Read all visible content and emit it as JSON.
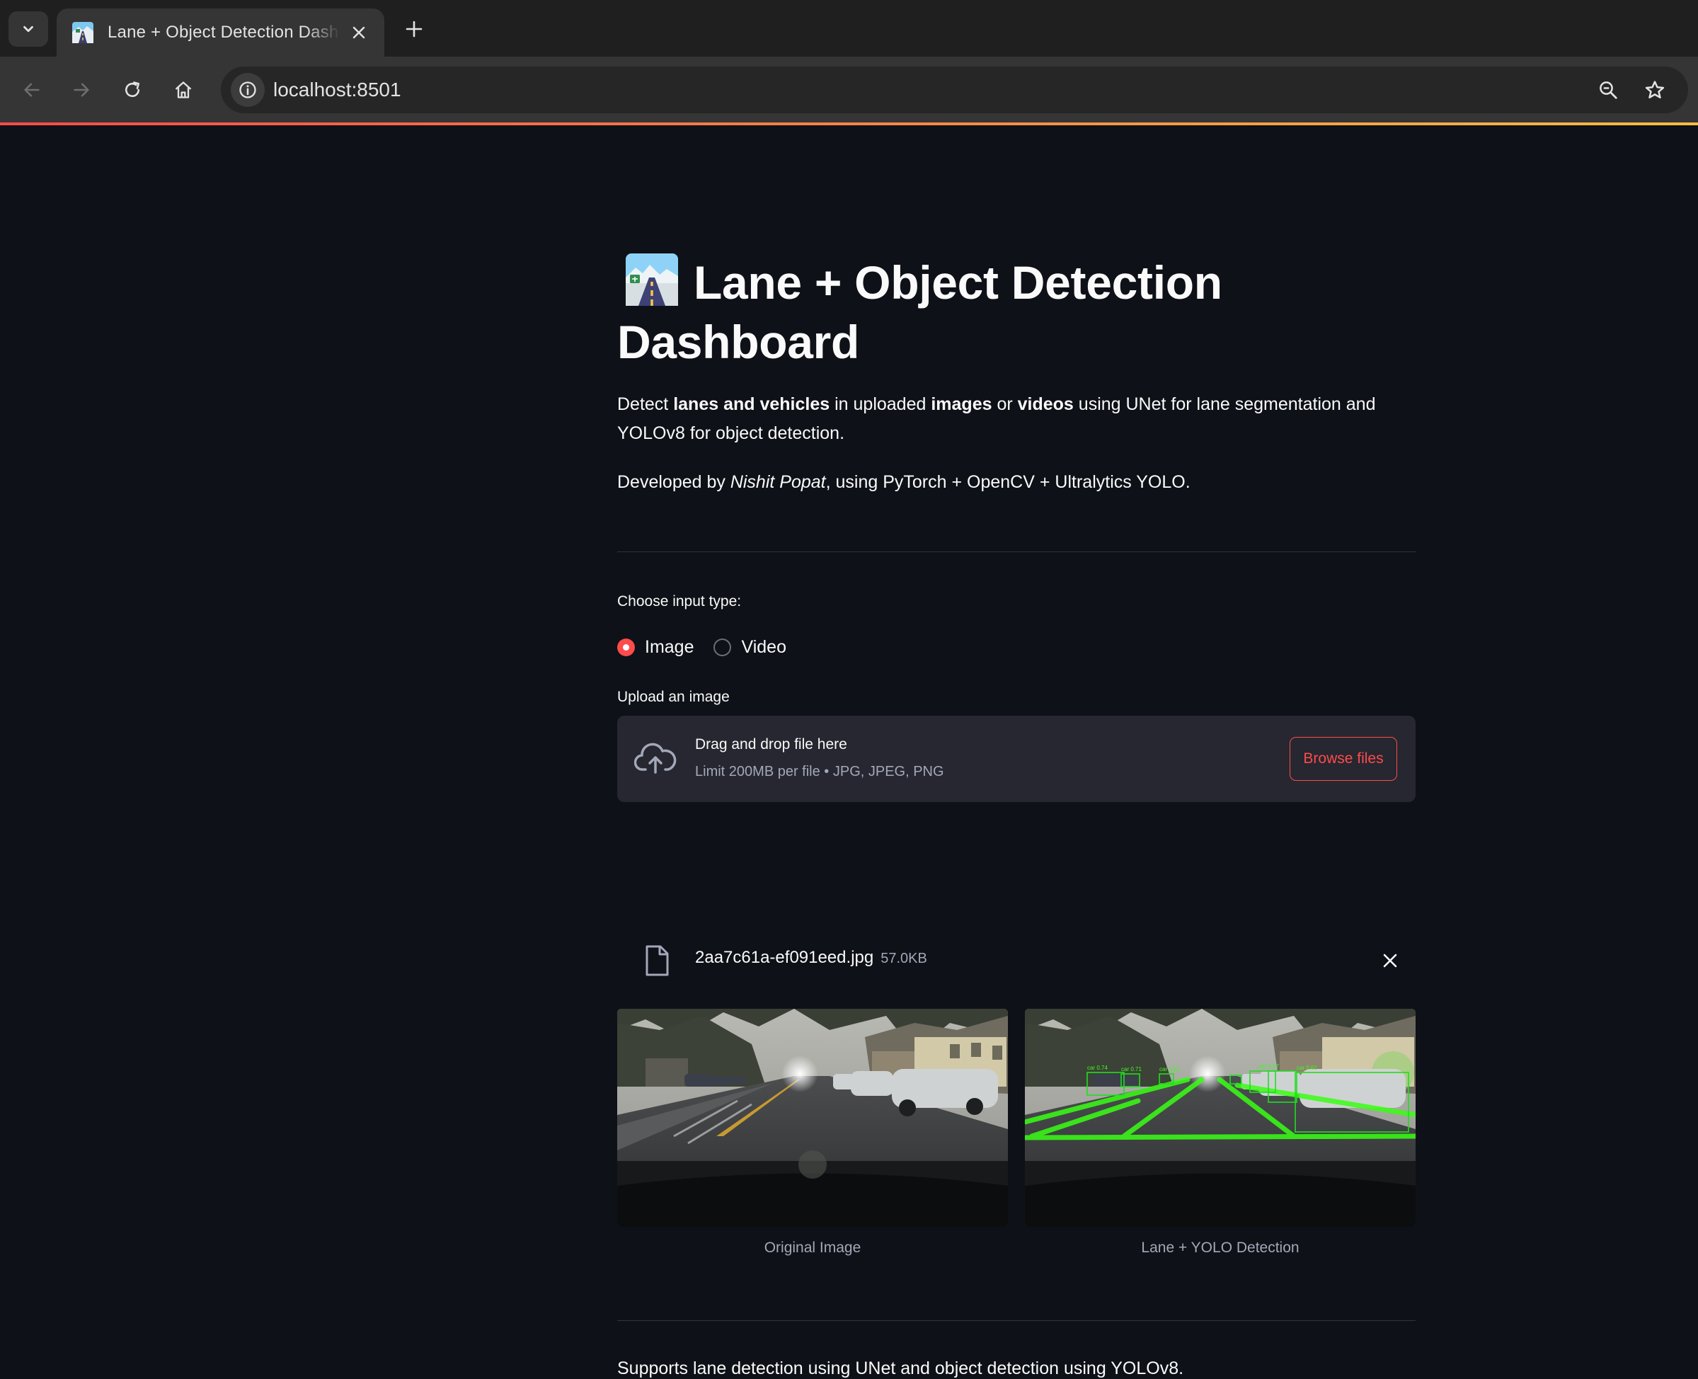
{
  "browser": {
    "tab_title": "Lane + Object Detection Dashboard",
    "url": "localhost:8501"
  },
  "app": {
    "title": "Lane + Object Detection Dashboard",
    "description": {
      "p1": "Detect ",
      "b1": "lanes and vehicles",
      "p2": " in uploaded ",
      "b2": "images",
      "p3": " or ",
      "b3": "videos",
      "p4": " using UNet for lane segmentation and YOLOv8 for object detection."
    },
    "developer": {
      "prefix": "Developed by ",
      "name": "Nishit Popat",
      "suffix": ", using PyTorch + OpenCV + Ultralytics YOLO."
    },
    "input_type": {
      "label": "Choose input type:",
      "options": [
        "Image",
        "Video"
      ],
      "selected": "Image"
    },
    "uploader": {
      "label": "Upload an image",
      "drag_text": "Drag and drop file here",
      "limit_text": "Limit 200MB per file • JPG, JPEG, PNG",
      "browse_label": "Browse files"
    },
    "uploaded_file": {
      "name": "2aa7c61a-ef091eed.jpg",
      "size": "57.0KB"
    },
    "results": {
      "original_caption": "Original Image",
      "detection_caption": "Lane + YOLO Detection",
      "detections": [
        "car 0.74",
        "car 0.71",
        "car 0.61",
        "car 0.57",
        "car 0.61"
      ]
    },
    "footer": "Supports lane detection using UNet and object detection using YOLOv8."
  },
  "colors": {
    "background": "#0e1117",
    "accent": "#ff4b4b",
    "lane_overlay": "#39ff14",
    "box": "#22dd22"
  }
}
